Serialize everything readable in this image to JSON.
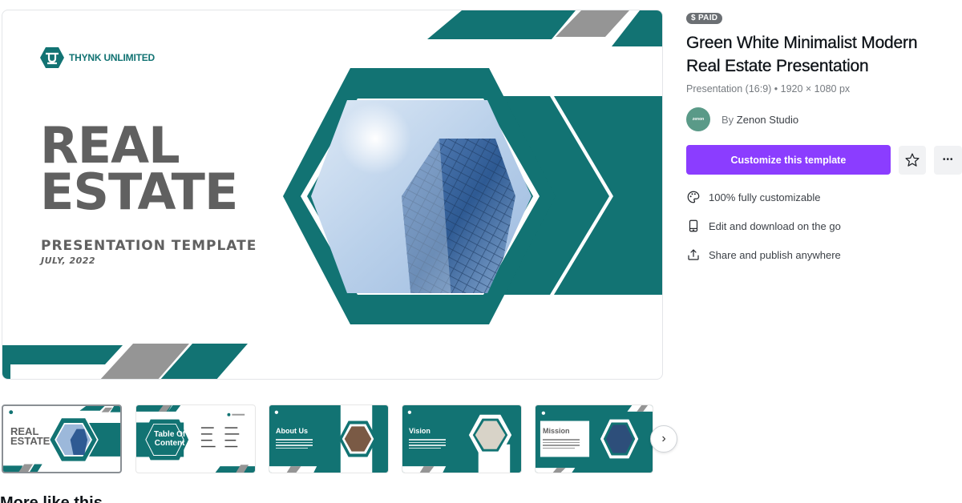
{
  "preview": {
    "brand": "THYNK UNLIMITED",
    "title_line1": "REAL",
    "title_line2": "ESTATE",
    "subtitle": "PRESENTATION TEMPLATE",
    "date": "JULY, 2022"
  },
  "colors": {
    "teal": "#127373",
    "gray_stripe": "#959595",
    "title_gray": "#606060",
    "cta_purple": "#8b3dff"
  },
  "thumbnails": [
    {
      "name": "cover",
      "title1": "REAL",
      "title2": "ESTATE",
      "selected": true
    },
    {
      "name": "table-of-content",
      "title1": "Table Of",
      "title2": "Content",
      "selected": false
    },
    {
      "name": "about-us",
      "title1": "About Us",
      "selected": false
    },
    {
      "name": "vision",
      "title1": "Vision",
      "selected": false
    },
    {
      "name": "mission",
      "title1": "Mission",
      "selected": false
    }
  ],
  "next_button": "›",
  "cut_heading": "More like this",
  "panel": {
    "badge": "$ PAID",
    "title_line1": "Green White Minimalist Modern",
    "title_line2": "Real Estate Presentation",
    "meta": "Presentation (16:9) • 1920 × 1080 px",
    "avatar_text": "zenon",
    "author_prefix": "By ",
    "author_name": "Zenon Studio",
    "cta_label": "Customize this template",
    "more_label": "•••",
    "features": [
      {
        "icon": "palette-icon",
        "label": "100% fully customizable"
      },
      {
        "icon": "phone-icon",
        "label": "Edit and download on the go"
      },
      {
        "icon": "share-icon",
        "label": "Share and publish anywhere"
      }
    ]
  }
}
